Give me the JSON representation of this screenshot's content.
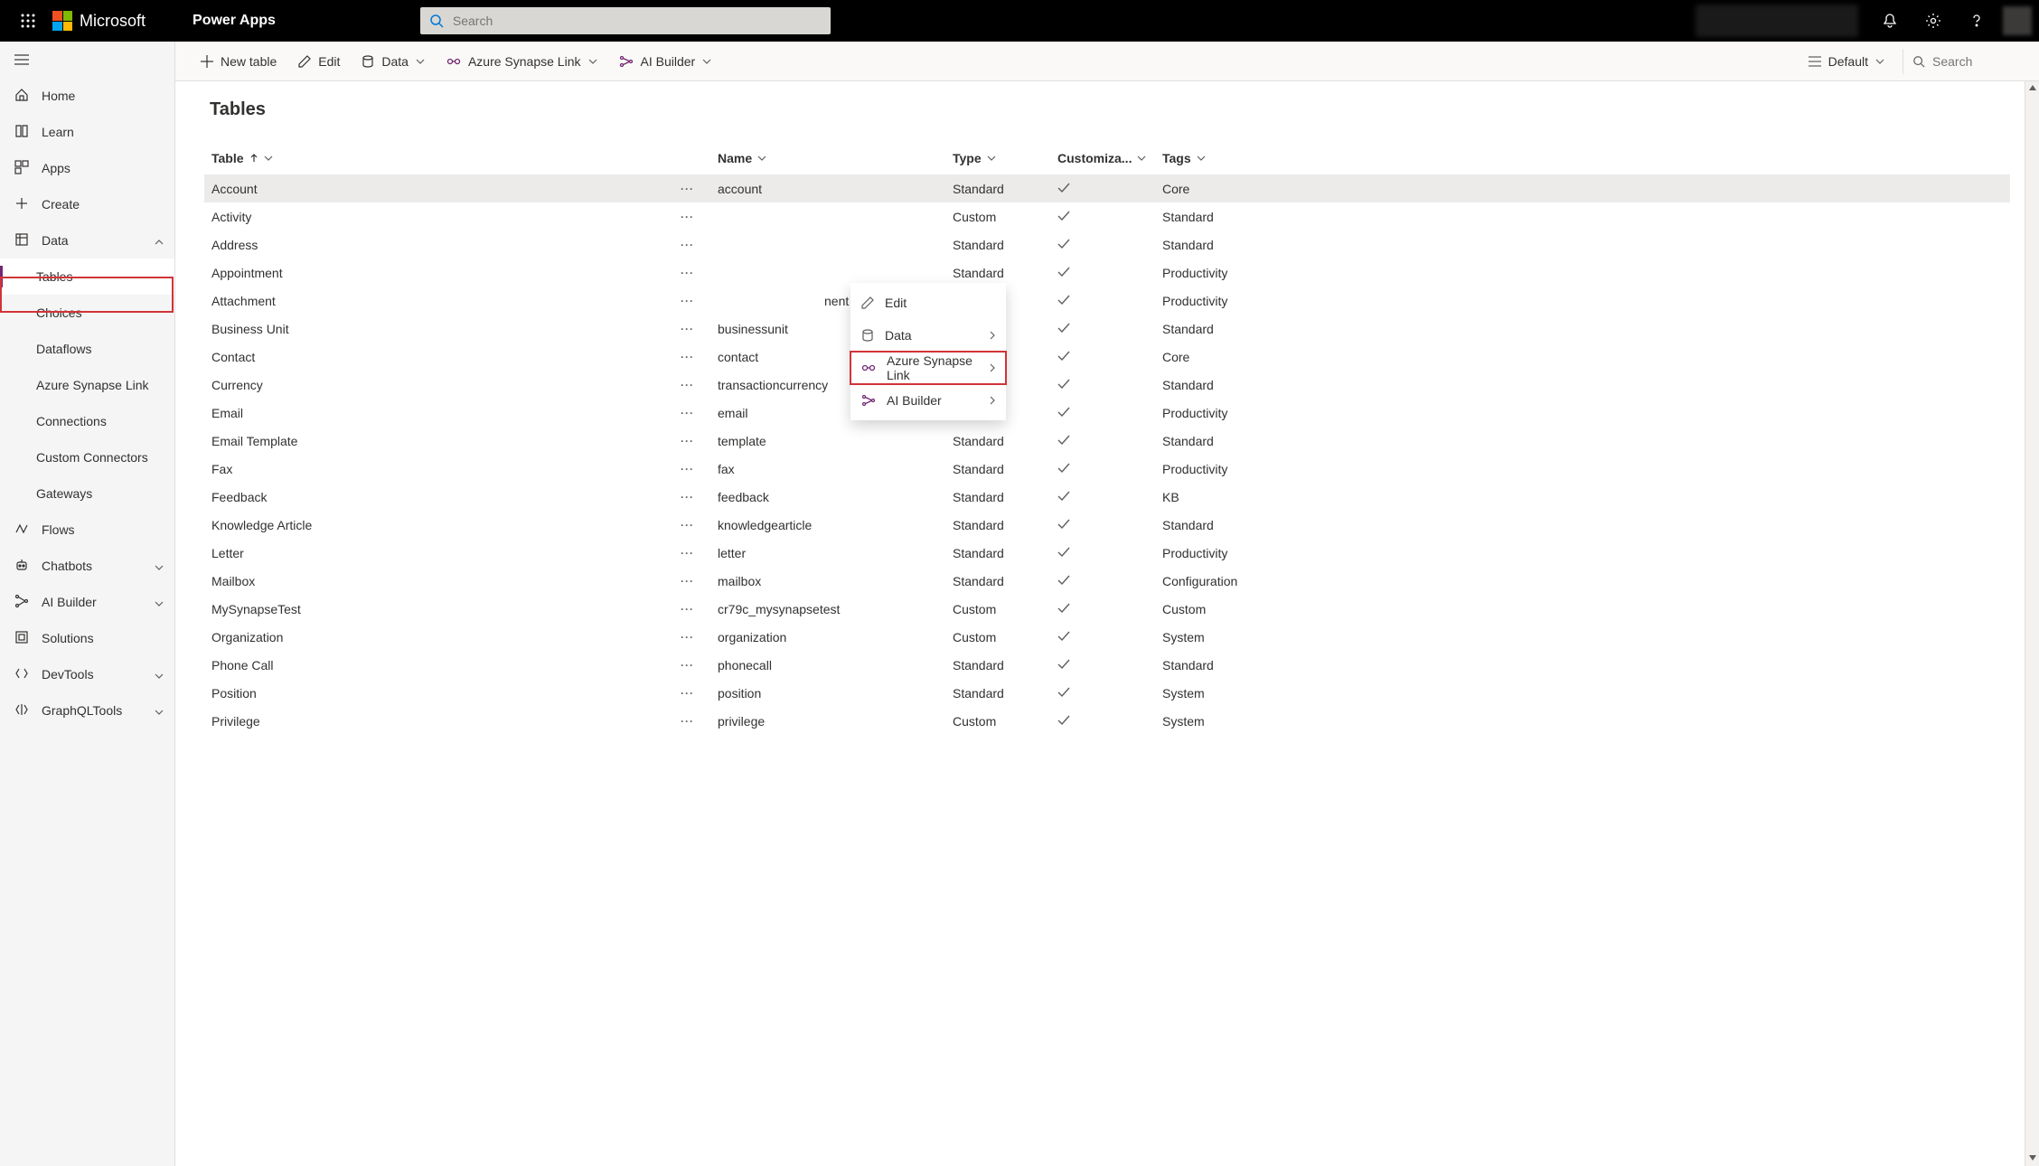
{
  "header": {
    "brand": "Microsoft",
    "app": "Power Apps",
    "search_placeholder": "Search"
  },
  "left_nav": {
    "items": [
      {
        "icon": "home",
        "label": "Home"
      },
      {
        "icon": "book",
        "label": "Learn"
      },
      {
        "icon": "grid",
        "label": "Apps"
      },
      {
        "icon": "plus",
        "label": "Create"
      },
      {
        "icon": "db",
        "label": "Data",
        "expandable": true,
        "expanded": true
      },
      {
        "icon": "",
        "label": "Tables",
        "sub": true,
        "active": true
      },
      {
        "icon": "",
        "label": "Choices",
        "sub": true
      },
      {
        "icon": "",
        "label": "Dataflows",
        "sub": true
      },
      {
        "icon": "",
        "label": "Azure Synapse Link",
        "sub": true
      },
      {
        "icon": "",
        "label": "Connections",
        "sub": true
      },
      {
        "icon": "",
        "label": "Custom Connectors",
        "sub": true
      },
      {
        "icon": "",
        "label": "Gateways",
        "sub": true
      },
      {
        "icon": "flow",
        "label": "Flows"
      },
      {
        "icon": "bot",
        "label": "Chatbots",
        "expandable": true
      },
      {
        "icon": "ai",
        "label": "AI Builder",
        "expandable": true
      },
      {
        "icon": "sol",
        "label": "Solutions"
      },
      {
        "icon": "dev",
        "label": "DevTools",
        "expandable": true
      },
      {
        "icon": "gql",
        "label": "GraphQLTools",
        "expandable": true
      }
    ]
  },
  "command_bar": {
    "new_table": "New table",
    "edit": "Edit",
    "data": "Data",
    "azure": "Azure Synapse Link",
    "ai": "AI Builder",
    "view": "Default",
    "search_placeholder": "Search"
  },
  "page": {
    "title": "Tables"
  },
  "columns": {
    "table": "Table",
    "name": "Name",
    "type": "Type",
    "custom": "Customiza...",
    "tags": "Tags"
  },
  "rows": [
    {
      "table": "Account",
      "name": "account",
      "type": "Standard",
      "custom": true,
      "tags": "Core",
      "sel": true
    },
    {
      "table": "Activity",
      "name": "",
      "type": "Custom",
      "custom": true,
      "tags": "Standard"
    },
    {
      "table": "Address",
      "name": "",
      "type": "Standard",
      "custom": true,
      "tags": "Standard"
    },
    {
      "table": "Appointment",
      "name": "",
      "type": "Standard",
      "custom": true,
      "tags": "Productivity"
    },
    {
      "table": "Attachment",
      "name": "nent",
      "type": "Standard",
      "custom": true,
      "tags": "Productivity",
      "partial": true
    },
    {
      "table": "Business Unit",
      "name": "businessunit",
      "type": "Standard",
      "custom": true,
      "tags": "Standard"
    },
    {
      "table": "Contact",
      "name": "contact",
      "type": "Standard",
      "custom": true,
      "tags": "Core"
    },
    {
      "table": "Currency",
      "name": "transactioncurrency",
      "type": "Standard",
      "custom": true,
      "tags": "Standard"
    },
    {
      "table": "Email",
      "name": "email",
      "type": "Standard",
      "custom": true,
      "tags": "Productivity"
    },
    {
      "table": "Email Template",
      "name": "template",
      "type": "Standard",
      "custom": true,
      "tags": "Standard"
    },
    {
      "table": "Fax",
      "name": "fax",
      "type": "Standard",
      "custom": true,
      "tags": "Productivity"
    },
    {
      "table": "Feedback",
      "name": "feedback",
      "type": "Standard",
      "custom": true,
      "tags": "KB"
    },
    {
      "table": "Knowledge Article",
      "name": "knowledgearticle",
      "type": "Standard",
      "custom": true,
      "tags": "Standard"
    },
    {
      "table": "Letter",
      "name": "letter",
      "type": "Standard",
      "custom": true,
      "tags": "Productivity"
    },
    {
      "table": "Mailbox",
      "name": "mailbox",
      "type": "Standard",
      "custom": true,
      "tags": "Configuration"
    },
    {
      "table": "MySynapseTest",
      "name": "cr79c_mysynapsetest",
      "type": "Custom",
      "custom": true,
      "tags": "Custom"
    },
    {
      "table": "Organization",
      "name": "organization",
      "type": "Custom",
      "custom": true,
      "tags": "System"
    },
    {
      "table": "Phone Call",
      "name": "phonecall",
      "type": "Standard",
      "custom": true,
      "tags": "Standard"
    },
    {
      "table": "Position",
      "name": "position",
      "type": "Standard",
      "custom": true,
      "tags": "System"
    },
    {
      "table": "Privilege",
      "name": "privilege",
      "type": "Custom",
      "custom": true,
      "tags": "System"
    }
  ],
  "context_menu": {
    "edit": "Edit",
    "data": "Data",
    "azure": "Azure Synapse Link",
    "ai": "AI Builder"
  }
}
